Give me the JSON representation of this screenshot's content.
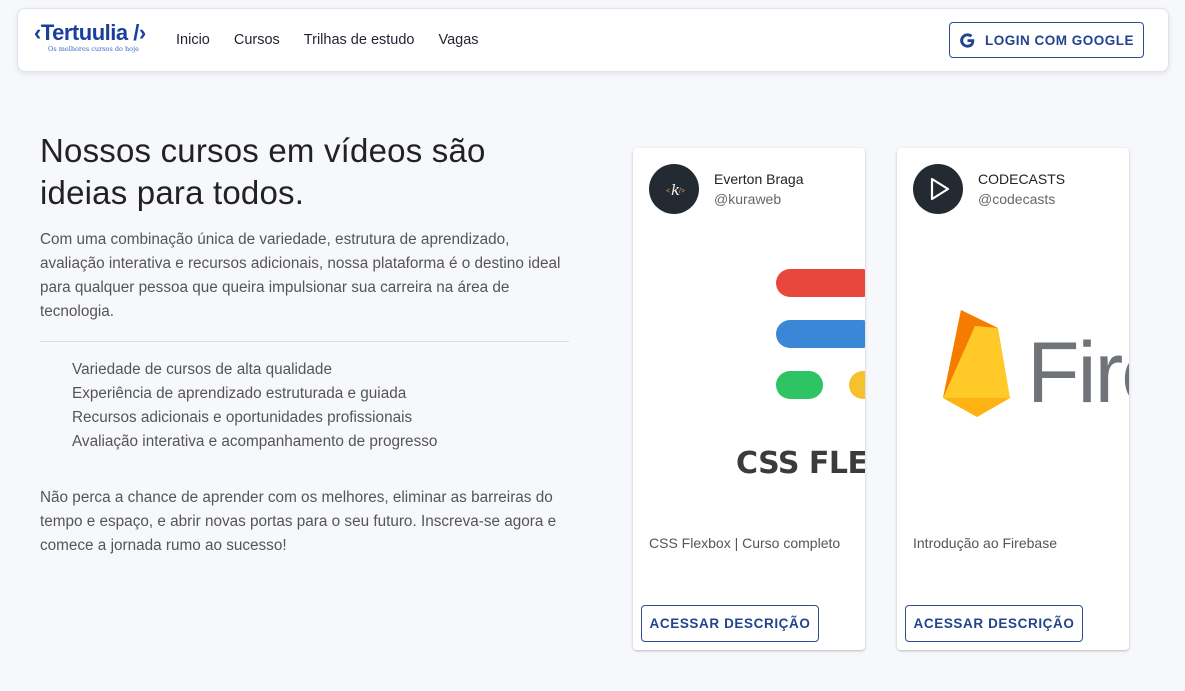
{
  "brand": {
    "name": "‹Tertuulia /›",
    "tagline": "Os melhores cursos do hoje"
  },
  "nav": {
    "items": [
      {
        "label": "Inicio"
      },
      {
        "label": "Cursos"
      },
      {
        "label": "Trilhas de estudo"
      },
      {
        "label": "Vagas"
      }
    ]
  },
  "login": {
    "label": "LOGIN COM GOOGLE",
    "icon": "google-g-icon"
  },
  "hero": {
    "title": "Nossos cursos em vídeos são ideias para todos.",
    "intro": "Com uma combinação única de variedade, estrutura de aprendizado, avaliação interativa e recursos adicionais, nossa plataforma é o destino ideal para qualquer pessoa que queira impulsionar sua carreira na área de tecnologia.",
    "features": [
      "Variedade de cursos de alta qualidade",
      "Experiência de aprendizado estruturada e guiada",
      "Recursos adicionais e oportunidades profissionais",
      "Avaliação interativa e acompanhamento de progresso"
    ],
    "outro": "Não perca a chance de aprender com os melhores, eliminar as barreiras do tempo e espaço, e abrir novas portas para o seu futuro. Inscreva-se agora e comece a jornada rumo ao sucesso!"
  },
  "courses": [
    {
      "author": "Everton Braga",
      "handle": "@kuraweb",
      "avatar_icon": "kuraweb-k-logo",
      "thumbnail_text": "CSS FLEXBOX",
      "title": "CSS Flexbox | Curso completo",
      "button": "ACESSAR DESCRIÇÃO"
    },
    {
      "author": "CODECASTS",
      "handle": "@codecasts",
      "avatar_icon": "play-icon",
      "thumbnail_text": "Firebase",
      "title": "Introdução ao Firebase",
      "button": "ACESSAR DESCRIÇÃO"
    }
  ],
  "colors": {
    "primary": "#23448c",
    "logo": "#1b3f9c",
    "avatar_bg": "#232a31",
    "flex_red": "#e8473d",
    "flex_blue": "#3a87d8",
    "flex_green": "#2ec464",
    "flex_yellow": "#f6c02e",
    "fire_orange": "#f5a623"
  }
}
